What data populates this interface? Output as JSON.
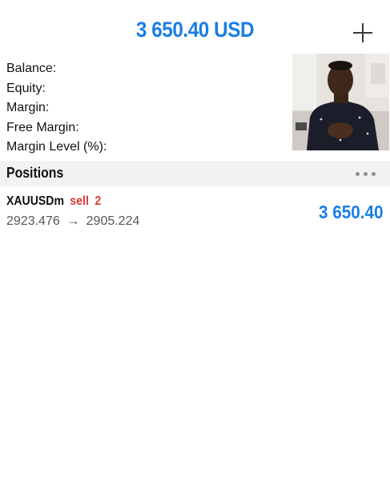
{
  "header": {
    "total": "3 650.40 USD",
    "add_icon": "plus-icon"
  },
  "account": {
    "balance_label": "Balance:",
    "equity_label": "Equity:",
    "margin_label": "Margin:",
    "free_margin_label": "Free Margin:",
    "margin_level_label": "Margin Level (%):"
  },
  "video": {
    "icon": "video-thumbnail"
  },
  "positions": {
    "title": "Positions",
    "more_icon": "more-horizontal-icon",
    "items": [
      {
        "symbol": "XAUUSDm",
        "type": "sell",
        "volume": "2",
        "open_price": "2923.476",
        "arrow": "→",
        "current_price": "2905.224",
        "profit": "3 650.40"
      }
    ]
  },
  "colors": {
    "accent": "#1b7ee6",
    "sell": "#d93a2f",
    "section_bg": "#f2f2f4"
  }
}
